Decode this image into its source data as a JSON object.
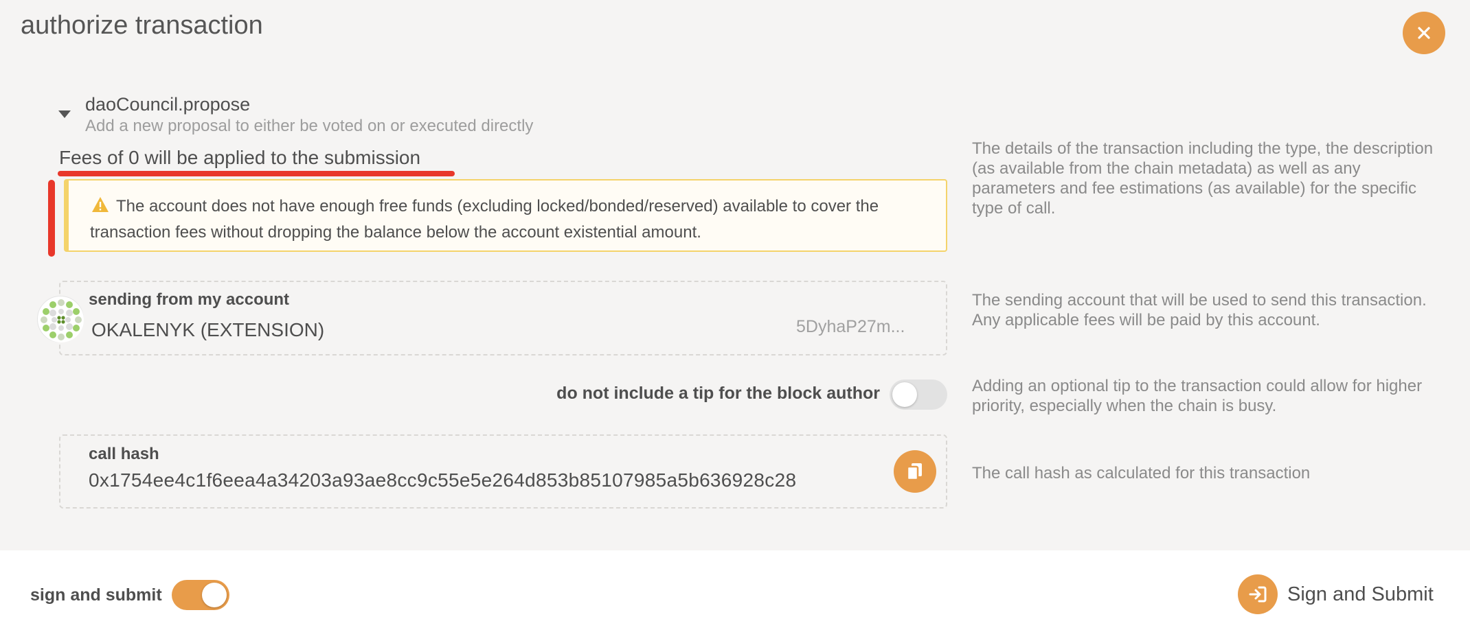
{
  "header": {
    "title": "authorize transaction",
    "close_icon": "close-icon"
  },
  "call": {
    "method": "daoCouncil.propose",
    "description": "Add a new proposal to either be voted on or executed directly",
    "fees": "Fees of 0 will be applied to the submission",
    "help": "The details of the transaction including the type, the description (as available from the chain metadata) as well as any parameters and fee estimations (as available) for the specific type of call."
  },
  "warning": {
    "icon": "warning-icon",
    "text": "The account does not have enough free funds (excluding locked/bonded/reserved) available to cover the transaction fees without dropping the balance below the account existential amount."
  },
  "account": {
    "label": "sending from my account",
    "name": "OKALENYK (EXTENSION)",
    "address": "5DyhaP27m...",
    "help": "The sending account that will be used to send this transaction. Any applicable fees will be paid by this account."
  },
  "tip": {
    "label": "do not include a tip for the block author",
    "enabled": false,
    "help": "Adding an optional tip to the transaction could allow for higher priority, especially when the chain is busy."
  },
  "call_hash": {
    "label": "call hash",
    "value": "0x1754ee4c1f6eea4a34203a93ae8cc9c55e5e264d853b85107985a5b636928c28",
    "copy_icon": "copy-icon",
    "help": "The call hash as calculated for this transaction"
  },
  "footer": {
    "sign_label": "sign and submit",
    "sign_enabled": true,
    "submit_label": "Sign and Submit",
    "submit_icon": "sign-in-icon"
  },
  "colors": {
    "accent": "#e89c4a",
    "annotation": "#e8372a",
    "warning_border": "#f4d36a"
  }
}
